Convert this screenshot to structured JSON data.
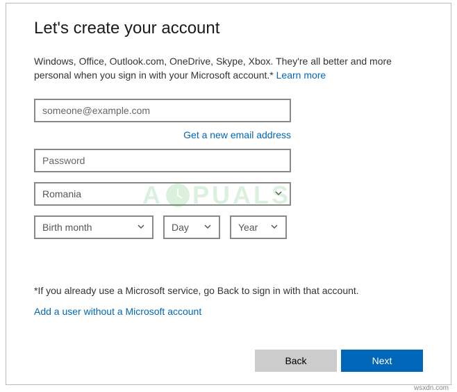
{
  "title": "Let's create your account",
  "description": "Windows, Office, Outlook.com, OneDrive, Skype, Xbox. They're all better and more personal when you sign in with your Microsoft account.*",
  "learn_more": "Learn more",
  "email_placeholder": "someone@example.com",
  "get_new_email": "Get a new email address",
  "password_placeholder": "Password",
  "country_value": "Romania",
  "birth_month": "Birth month",
  "birth_day": "Day",
  "birth_year": "Year",
  "footnote": "*If you already use a Microsoft service, go Back to sign in with that account.",
  "add_user_link": "Add a user without a Microsoft account",
  "back_label": "Back",
  "next_label": "Next",
  "watermark_part1": "A",
  "watermark_part2": "PUALS",
  "attribution": "wsxdn.com"
}
